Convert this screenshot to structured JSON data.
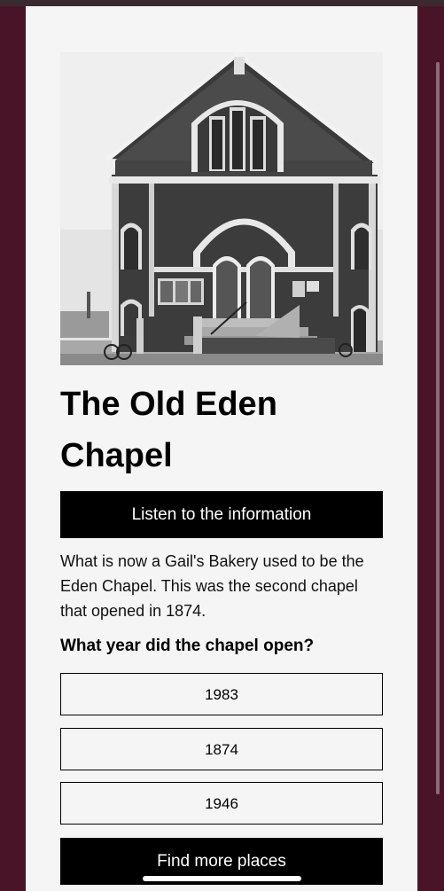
{
  "page": {
    "title": "The Old Eden Chapel",
    "listen_button": "Listen to the information",
    "description": "What is now a Gail's Bakery used to be the Eden Chapel. This was the second chapel that opened in 1874.",
    "question": "What year did the chapel open?",
    "options": [
      "1983",
      "1874",
      "1946"
    ],
    "more_button": "Find more places"
  },
  "colors": {
    "background": "#4a1428",
    "card": "#f5f5f5",
    "button": "#000000"
  },
  "image": {
    "name": "chapel-photo",
    "style": "black-and-white"
  }
}
